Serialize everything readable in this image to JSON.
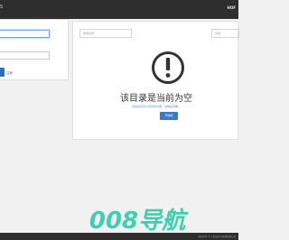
{
  "header": {
    "brand": "S",
    "brand_sub": "",
    "nav_link": "HOF"
  },
  "login": {
    "username_placeholder": "",
    "password_placeholder": "",
    "register_label": "注册"
  },
  "main": {
    "search_placeholder": "搜索目录",
    "filter_placeholder": "筛选",
    "empty_title": "该目录是当前为空",
    "empty_desc": "当前没有可以浏览的内容，请稍后查看。",
    "action_label": "开始吧"
  },
  "watermark": {
    "text": "008导航"
  },
  "footer": {
    "text": "版权所有 © 工程运营与管理有限公司"
  },
  "colors": {
    "topbar": "#2e2e2e",
    "accent": "#3a78c9",
    "watermark": "#3fcfb0"
  }
}
